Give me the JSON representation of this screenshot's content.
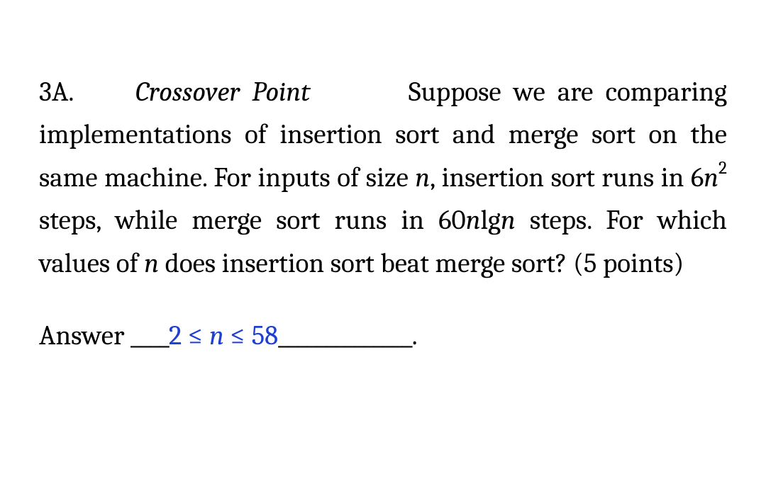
{
  "problem": {
    "number": "3A.",
    "title": "Crossover Point",
    "text_part1": "Suppose we are comparing implementations of insertion sort and merge sort on the same machine.  For inputs of size ",
    "var_n1": "n",
    "text_part2": ", insertion sort runs in 6",
    "var_n2": "n",
    "exponent": "2",
    "text_part3": " steps, while merge sort runs in 60",
    "var_n3": "n",
    "text_lg": "lg",
    "var_n4": "n",
    "text_part4": " steps.  For which values of ",
    "var_n5": "n",
    "text_part5": " does insertion sort beat merge sort?  (5 points)"
  },
  "answer": {
    "label": "Answer ",
    "blank_before": "____",
    "value_prefix": "2 ≤ ",
    "value_var": "n",
    "value_suffix": " ≤ 58",
    "blank_after": "______________",
    "period": "."
  }
}
